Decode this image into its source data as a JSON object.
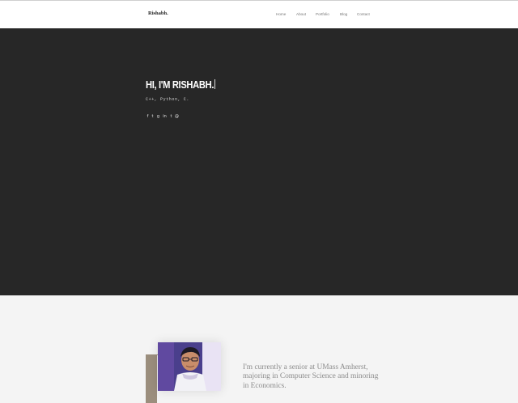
{
  "navbar": {
    "brand": "Rishabh.",
    "links": [
      {
        "label": "Home"
      },
      {
        "label": "About"
      },
      {
        "label": "Portfolio"
      },
      {
        "label": "Blog"
      },
      {
        "label": "Contact"
      }
    ]
  },
  "hero": {
    "title": "HI, I'M RISHABH.",
    "subtitle": "C++, Python, C.",
    "social_icons": [
      {
        "name": "facebook-icon",
        "glyph": "f"
      },
      {
        "name": "twitter-icon",
        "glyph": "t"
      },
      {
        "name": "github-icon",
        "glyph": "g"
      },
      {
        "name": "linkedin-icon",
        "glyph": "in"
      },
      {
        "name": "tumblr-icon",
        "glyph": "t"
      },
      {
        "name": "mail-icon",
        "glyph": "@"
      }
    ]
  },
  "about": {
    "text": "I'm currently a senior at UMass Amherst, majoring in Computer Science and minoring in Economics."
  },
  "colors": {
    "hero_background": "#272727",
    "page_background": "#f4f4f4",
    "frame_accent": "#9b8e7d",
    "about_text": "#8c8c8c"
  }
}
